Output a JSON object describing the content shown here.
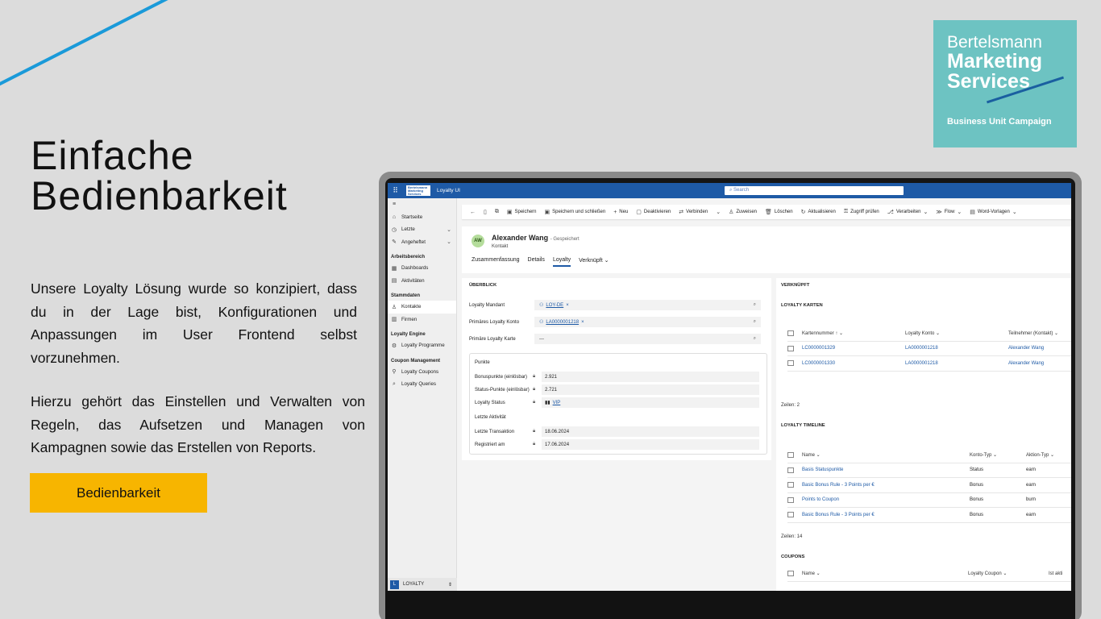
{
  "slide": {
    "headline_line1": "Einfache",
    "headline_line2": "Bedienbarkeit",
    "paragraph1": "Unsere Loyalty Lösung wurde so konzipiert, dass du in der Lage bist, Konfigurationen und Anpassungen im User Frontend selbst vorzunehmen.",
    "paragraph2": "Hierzu gehört das Einstellen und Verwalten von Regeln, das Aufsetzen und Managen von Kampagnen sowie das Erstellen von Reports.",
    "cta_label": "Bedienbarkeit",
    "accent_line_color": "#1a9ad9",
    "cta_color": "#f7b500"
  },
  "logo": {
    "line1": "Bertelsmann",
    "line2": "Marketing",
    "line3": "Services",
    "tagline": "Business Unit Campaign",
    "background": "#6dc3c2"
  },
  "app": {
    "mini_logo_l1": "Bertelsmann",
    "mini_logo_l2": "Marketing",
    "mini_logo_l3": "Services",
    "title": "Loyalty UI",
    "search_placeholder": "Search",
    "brand_color": "#1e5aa6"
  },
  "nav": {
    "items_top": [
      {
        "icon": "home-icon",
        "label": "Startseite"
      },
      {
        "icon": "clock-icon",
        "label": "Letzte"
      },
      {
        "icon": "pin-icon",
        "label": "Angeheftet"
      }
    ],
    "section_work": "Arbeitsbereich",
    "items_work": [
      {
        "label": "Dashboards"
      },
      {
        "label": "Aktivitäten"
      }
    ],
    "section_master": "Stammdaten",
    "items_master": [
      {
        "label": "Kontakte"
      },
      {
        "label": "Firmen"
      }
    ],
    "section_engine": "Loyalty Engine",
    "items_engine": [
      {
        "label": "Loyalty Programme"
      }
    ],
    "section_coupon": "Coupon Management",
    "items_coupon": [
      {
        "label": "Loyalty Coupons"
      },
      {
        "label": "Loyalty Queries"
      }
    ],
    "footer_badge": "L",
    "footer_label": "LOYALTY"
  },
  "cmdbar": {
    "save": "Speichern",
    "save_close": "Speichern und schließen",
    "new": "Neu",
    "deactivate": "Deaktivieren",
    "connect": "Verbinden",
    "assign": "Zuweisen",
    "delete": "Löschen",
    "refresh": "Aktualisieren",
    "check_access": "Zugriff prüfen",
    "process": "Verarbeiten",
    "flow": "Flow",
    "word": "Word-Vorlagen"
  },
  "record": {
    "initials": "AW",
    "name": "Alexander Wang",
    "saved": "- Gespeichert",
    "type": "Kontakt",
    "tabs": [
      "Zusammenfassung",
      "Details",
      "Loyalty",
      "Verknüpft"
    ]
  },
  "overview": {
    "title": "ÜBERBLICK",
    "mandant_label": "Loyalty Mandant",
    "mandant_value": "LOY-DE",
    "konto_label": "Primäres Loyalty Konto",
    "konto_value": "LA0000001218",
    "karte_label": "Primäre Loyalty Karte",
    "karte_value": "---",
    "points_title": "Punkte",
    "bonus_label": "Bonuspunkte (einlösbar)",
    "bonus_value": "2.921",
    "status_label": "Status-Punkte (einlösbar)",
    "status_value": "2.721",
    "lstatus_label": "Loyalty Status",
    "lstatus_value": "VIP",
    "activity_title": "Letzte Aktivität",
    "trans_label": "Letzte Transaktion",
    "trans_value": "18.06.2024",
    "reg_label": "Registriert am",
    "reg_value": "17.06.2024"
  },
  "linked": {
    "title": "VERKNÜPFT",
    "cards_title": "LOYALTY KARTEN",
    "cards_headers": [
      "Kartennummer ↑",
      "Loyalty Konto",
      "Teilnehmer (Kontakt)"
    ],
    "cards_rows": [
      [
        "LC0000001329",
        "LA0000001218",
        "Alexander Wang"
      ],
      [
        "LC0000001330",
        "LA0000001218",
        "Alexander Wang"
      ]
    ],
    "cards_count": "Zeilen: 2",
    "timeline_title": "LOYALTY TIMELINE",
    "timeline_headers": [
      "Name",
      "Konto-Typ",
      "Aktion-Typ"
    ],
    "timeline_rows": [
      [
        "Basis Statuspunkte",
        "Status",
        "earn"
      ],
      [
        "Basic Bonus Rule - 3 Points per €",
        "Bonus",
        "earn"
      ],
      [
        "Points to Coupon",
        "Bonus",
        "burn"
      ],
      [
        "Basic Bonus Rule - 3 Points per €",
        "Bonus",
        "earn"
      ]
    ],
    "timeline_count": "Zeilen: 14",
    "coupons_title": "COUPONS",
    "coupons_headers": [
      "Name",
      "Loyalty Coupon",
      "Ist akti"
    ]
  }
}
